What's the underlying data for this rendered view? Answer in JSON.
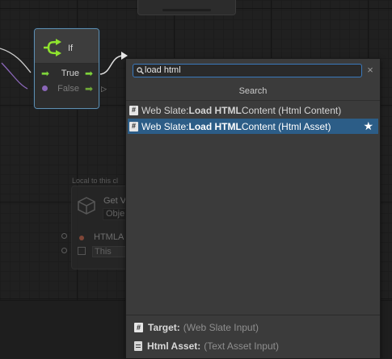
{
  "canvas": {
    "if_node": {
      "title": "If",
      "ports": [
        {
          "label": "True"
        },
        {
          "label": "False"
        }
      ]
    },
    "background_node": {
      "caption": "Local to this cl",
      "title": "Get V",
      "object_field": "Obje",
      "port_label": "HTMLA",
      "this_field": "This"
    }
  },
  "fuzzy_finder": {
    "search": {
      "value": "load html",
      "placeholder": ""
    },
    "clear_symbol": "×",
    "header": "Search",
    "results": [
      {
        "prefix": "Web Slate: ",
        "bold": "Load HTML",
        "suffix": " Content (Html Content)",
        "icon": "hash-icon",
        "selected": false,
        "favorite": false
      },
      {
        "prefix": "Web Slate: ",
        "bold": "Load HTML",
        "suffix": " Content (Html Asset)",
        "icon": "hash-icon",
        "selected": true,
        "favorite": true
      }
    ],
    "details": [
      {
        "key": "Target:",
        "value": "(Web Slate Input)",
        "icon": "hash-icon"
      },
      {
        "key": "Html Asset:",
        "value": "(Text Asset Input)",
        "icon": "document-icon"
      }
    ]
  },
  "colors": {
    "accent_blue": "#3a79bd",
    "selected_row": "#2c5d87",
    "control_green": "#7fd33b",
    "canvas_bg": "#202020"
  }
}
